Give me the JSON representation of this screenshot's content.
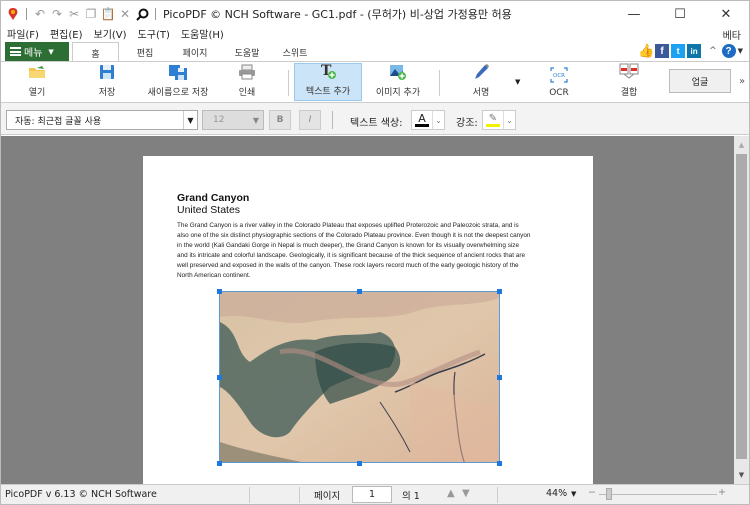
{
  "window": {
    "title": "PicoPDF © NCH Software - GC1.pdf - (무허가) 비-상업 가정용만 허용",
    "controls": {
      "minimize": "—",
      "maximize": "☐",
      "close": "✕"
    }
  },
  "quick_access": [
    "app-logo-icon",
    "undo-icon",
    "redo-icon",
    "cut-icon",
    "copy-icon",
    "paste-icon",
    "delete-icon",
    "search-icon"
  ],
  "menubar": {
    "items": [
      {
        "label": "파일(F)"
      },
      {
        "label": "편집(E)"
      },
      {
        "label": "보기(V)"
      },
      {
        "label": "도구(T)"
      },
      {
        "label": "도움말(H)"
      }
    ],
    "beta_label": "베타"
  },
  "ribbon_tabs": {
    "menu_button": "메뉴",
    "tabs": [
      {
        "label": "홈",
        "active": true
      },
      {
        "label": "편집",
        "active": false
      },
      {
        "label": "페이지",
        "active": false
      },
      {
        "label": "도움말",
        "active": false
      },
      {
        "label": "스위트",
        "active": false
      }
    ]
  },
  "social": [
    "like-icon",
    "facebook-icon",
    "twitter-icon",
    "linkedin-icon"
  ],
  "ribbon": {
    "buttons": [
      {
        "label": "열기",
        "icon": "open-folder-icon"
      },
      {
        "label": "저장",
        "icon": "save-icon"
      },
      {
        "label": "새이름으로 저장",
        "icon": "save-as-icon"
      },
      {
        "label": "인쇄",
        "icon": "print-icon"
      },
      {
        "label": "텍스트 추가",
        "icon": "add-text-icon",
        "active": true
      },
      {
        "label": "이미지 추가",
        "icon": "add-image-icon"
      },
      {
        "label": "서명",
        "icon": "signature-icon"
      },
      {
        "label": "OCR",
        "icon": "ocr-icon"
      },
      {
        "label": "결합",
        "icon": "merge-icon"
      }
    ],
    "upgrade_label": "업글",
    "more": "»"
  },
  "format_bar": {
    "font": "자동: 최근접 글꼴 사용",
    "size": "12",
    "bold": "B",
    "italic": "I",
    "text_color_label": "텍스트 색상:",
    "text_color": "#000000",
    "highlight_label": "강조:",
    "highlight_color": "#f2f200"
  },
  "document": {
    "title": "Grand Canyon",
    "subtitle": "United States",
    "body_lines": [
      "The Grand Canyon is a river valley in the Colorado Plateau that exposes uplifted Proterozoic and Paleozoic strata, and is",
      "also one of the six distinct physiographic sections of the Colorado Plateau province. Even though it is not the deepest canyon",
      "in the world (Kali Gandaki Gorge in Nepal is much deeper), the Grand Canyon is known for its visually overwhelming size",
      "and its intricate and colorful landscape. Geologically, it is significant because of the thick sequence of ancient rocks that are",
      "well preserved and exposed in the walls of the canyon. These rock layers record much of the early geologic history of the",
      "North American continent."
    ]
  },
  "statusbar": {
    "version": "PicoPDF v 6.13 © NCH Software",
    "page_label": "페이지",
    "page_current": "1",
    "page_of": "의 1",
    "zoom": "44%",
    "zoom_minus": "−",
    "zoom_plus": "+"
  }
}
